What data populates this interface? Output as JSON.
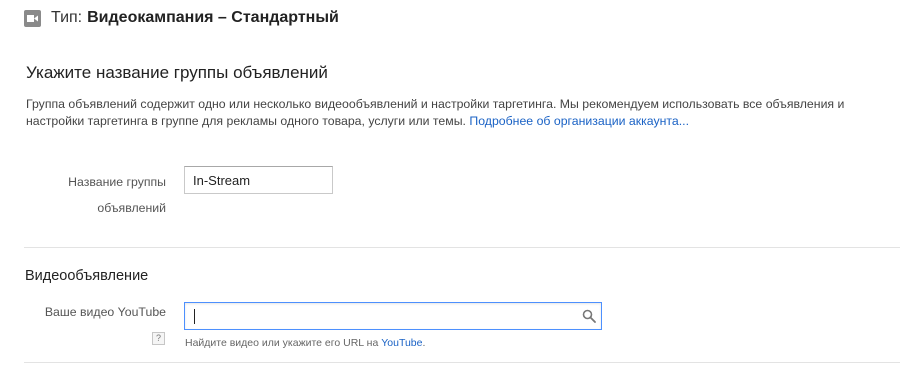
{
  "campaign": {
    "type_label": "Тип:",
    "type_value": "Видеокампания – Стандартный",
    "icon": "video-camera-icon"
  },
  "ad_group": {
    "title": "Укажите название группы объявлений",
    "description": "Группа объявлений содержит одно или несколько видеообъявлений и настройки таргетинга. Мы рекомендуем использовать все объявления и настройки таргетинга в группе для рекламы одного товара, услуги или темы.",
    "learn_more_link": "Подробнее об организации аккаунта...",
    "name_label_line1": "Название группы",
    "name_label_line2": "объявлений",
    "name_value": "In-Stream"
  },
  "video_ad": {
    "title": "Видеообъявление",
    "youtube_label": "Ваше видео YouTube",
    "help_icon_text": "?",
    "search_value": "",
    "search_icon": "search-icon",
    "hint_text": "Найдите видео или укажите его URL на",
    "hint_link": "YouTube",
    "hint_suffix": "."
  },
  "colors": {
    "link": "#1a62c5",
    "focus_border": "#4d90fe",
    "divider": "#e3e3e3"
  }
}
